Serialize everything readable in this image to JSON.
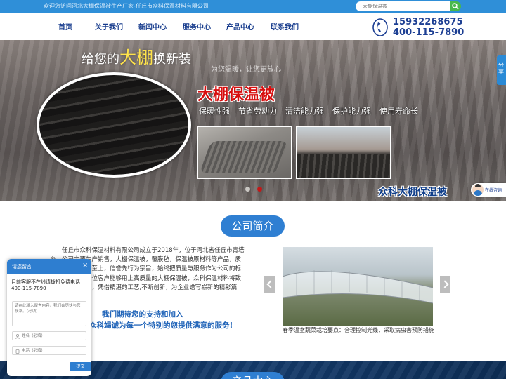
{
  "topbar": {
    "welcome": "欢迎您访问河北大棚保温被生产厂家-任丘市众科保温材料有限公司",
    "search_placeholder": "大棚保温被"
  },
  "nav": {
    "items": [
      {
        "label": "首页"
      },
      {
        "label": "关于我们"
      },
      {
        "label": "新闻中心"
      },
      {
        "label": "服务中心"
      },
      {
        "label": "产品中心"
      },
      {
        "label": "联系我们"
      }
    ],
    "phone_1": "15932268675",
    "phone_2": "400-115-7890"
  },
  "banner": {
    "slogan_pre": "给您的",
    "slogan_highlight": "大棚",
    "slogan_post": "换新装",
    "sub": "为您温暖，让您更放心",
    "product_title": "大棚保温被",
    "features": [
      "保暖性强",
      "节省劳动力",
      "清洁能力强",
      "保护能力强",
      "使用寿命长"
    ],
    "brand_caption": "众科大棚保温被"
  },
  "side": {
    "share_label": "分享",
    "online_service": "在线咨询"
  },
  "about": {
    "title": "公司简介",
    "text": "任丘市众科保温材料有限公司成立于2018年，位于河北省任丘市青塔乡，公司主要生产销售，大棚保温被，覆膜毡，保温被原材料等产品，质量可靠，以顾客至上，信誉先行为宗旨，始终把质量与服务作为公司的标尺，确保让每一位客户能够用上高质量的大棚保温被，众科保温材料将致力于每一个细节，凭借精湛的工艺,不断创新，为企业谱写崭新的精彩篇章。",
    "slogan_1": "我们期待您的支持和加入",
    "slogan_2": "众科竭诚为每一个特别的您提供满意的服务!",
    "gallery_caption": "春季温室蔬菜栽培要点：合理控制光线，采取病虫害预防措施"
  },
  "next_section": {
    "title": "产品中心"
  },
  "message_widget": {
    "title": "请您留言",
    "close": "×",
    "notice": "目前客服不在线请拨打免费电话400-115-7890",
    "content_placeholder": "请在此输入留言内容，我们会尽快与您联系。（必填）",
    "name_placeholder": "姓名（必填）",
    "phone_placeholder": "电话（必填）",
    "submit": "提交"
  },
  "colors": {
    "topbar": "#2f8fd8",
    "nav_text": "#153a8c",
    "accent_blue": "#2f7fd2",
    "title_red": "#d70f0f",
    "search_button": "#48b84c"
  }
}
